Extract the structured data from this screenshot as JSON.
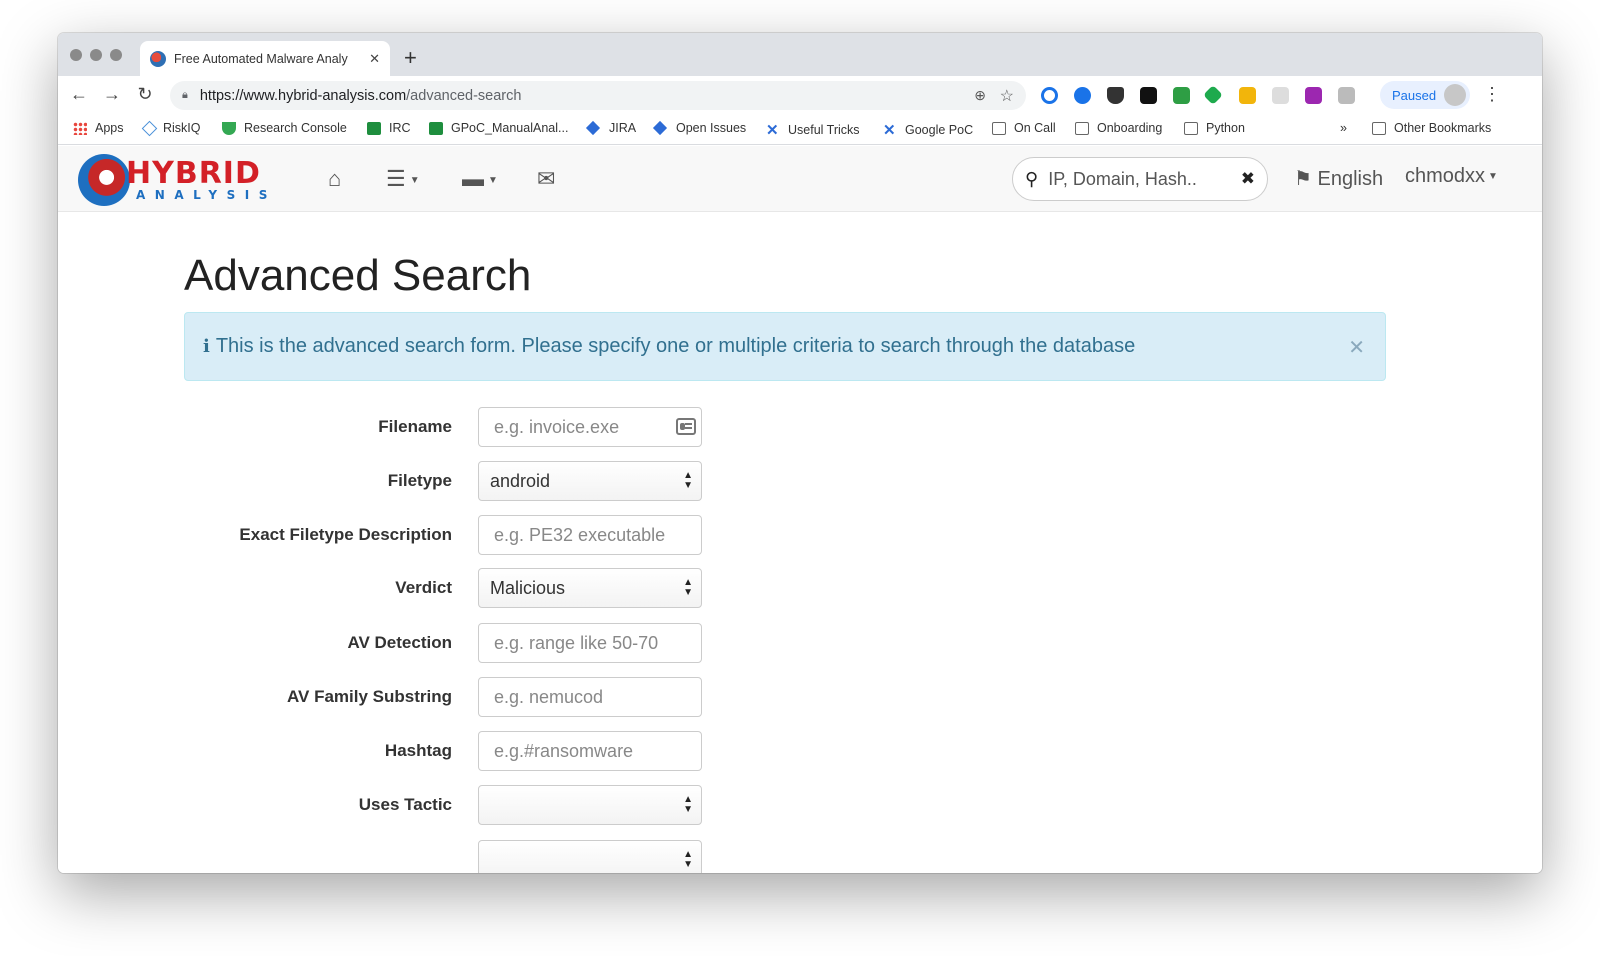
{
  "browser": {
    "tab_title": "Free Automated Malware Analy",
    "url_host": "https://www.hybrid-analysis.com",
    "url_path": "/advanced-search",
    "profile_status": "Paused"
  },
  "bookmarks": [
    {
      "label": "Apps",
      "icon": "apps-grid-icon"
    },
    {
      "label": "RiskIQ",
      "icon": "riskiq-icon"
    },
    {
      "label": "Research Console",
      "icon": "shield-icon"
    },
    {
      "label": "IRC",
      "icon": "sheets-icon"
    },
    {
      "label": "GPoC_ManualAnal...",
      "icon": "sheets-icon"
    },
    {
      "label": "JIRA",
      "icon": "jira-icon"
    },
    {
      "label": "Open Issues",
      "icon": "jira-icon"
    },
    {
      "label": "Useful Tricks",
      "icon": "confluence-icon"
    },
    {
      "label": "Google PoC",
      "icon": "confluence-icon"
    },
    {
      "label": "On Call",
      "icon": "folder-icon"
    },
    {
      "label": "Onboarding",
      "icon": "folder-icon"
    },
    {
      "label": "Python",
      "icon": "folder-icon"
    }
  ],
  "bookmarks_overflow": "»",
  "other_bookmarks": "Other Bookmarks",
  "site": {
    "logo_top": "HYBRID",
    "logo_bottom": "ANALYSIS",
    "search_placeholder": "IP, Domain, Hash...",
    "language": "English",
    "username": "chmodxx"
  },
  "page": {
    "title": "Advanced Search",
    "alert_text": "This is the advanced search form. Please specify one or multiple criteria to search through the database",
    "alert_icon": "i"
  },
  "form": {
    "filename": {
      "label": "Filename",
      "placeholder": "e.g. invoice.exe"
    },
    "filetype": {
      "label": "Filetype",
      "value": "android"
    },
    "filetype_desc": {
      "label": "Exact Filetype Description",
      "placeholder": "e.g. PE32 executable"
    },
    "verdict": {
      "label": "Verdict",
      "value": "Malicious"
    },
    "av_detection": {
      "label": "AV Detection",
      "placeholder": "e.g. range like 50-70"
    },
    "av_family": {
      "label": "AV Family Substring",
      "placeholder": "e.g. nemucod"
    },
    "hashtag": {
      "label": "Hashtag",
      "placeholder": "e.g.#ransomware"
    },
    "uses_tactic": {
      "label": "Uses Tactic",
      "value": ""
    }
  }
}
